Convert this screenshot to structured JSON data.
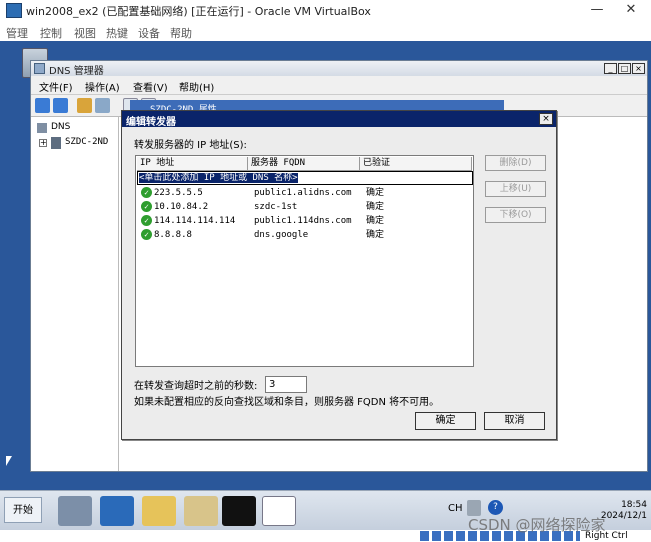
{
  "host": {
    "title": "win2008_ex2 (已配置基础网络) [正在运行] - Oracle VM VirtualBox",
    "menu": [
      "管理",
      "控制",
      "视图",
      "热键",
      "设备",
      "帮助"
    ],
    "controls": {
      "minimize": "—",
      "maximize": "☐",
      "close": "✕"
    }
  },
  "dns_manager": {
    "title": "DNS 管理器",
    "menu": [
      "文件(F)",
      "操作(A)",
      "查看(V)",
      "帮助(H)"
    ],
    "window_buttons": [
      "_",
      "□",
      "×"
    ],
    "tree": {
      "root": "DNS",
      "server": "SZDC-2ND"
    },
    "background_window_title": "SZDC-2ND 属性"
  },
  "dialog": {
    "title": "编辑转发器",
    "list_label": "转发服务器的 IP 地址(S):",
    "columns": [
      "IP 地址",
      "服务器 FQDN",
      "已验证"
    ],
    "add_placeholder": "<单击此处添加 IP 地址或 DNS 名称>",
    "rows": [
      {
        "ip": "223.5.5.5",
        "fqdn": "public1.alidns.com",
        "verified": "确定"
      },
      {
        "ip": "10.10.84.2",
        "fqdn": "szdc-1st",
        "verified": "确定"
      },
      {
        "ip": "114.114.114.114",
        "fqdn": "public1.114dns.com",
        "verified": "确定"
      },
      {
        "ip": "8.8.8.8",
        "fqdn": "dns.google",
        "verified": "确定"
      }
    ],
    "side_buttons": {
      "delete": "删除(D)",
      "move_up": "上移(U)",
      "move_down": "下移(O)"
    },
    "timeout_label": "在转发查询超时之前的秒数:",
    "timeout_value": "3",
    "note": "如果未配置相应的反向查找区域和条目，则服务器 FQDN 将不可用。",
    "ok": "确定",
    "cancel": "取消"
  },
  "taskbar": {
    "start": "开始",
    "lang": "CH",
    "time": "18:54",
    "date": "2024/12/1"
  },
  "status_bar": {
    "host_key": "Right Ctrl"
  },
  "watermark": "CSDN @网络探险家"
}
